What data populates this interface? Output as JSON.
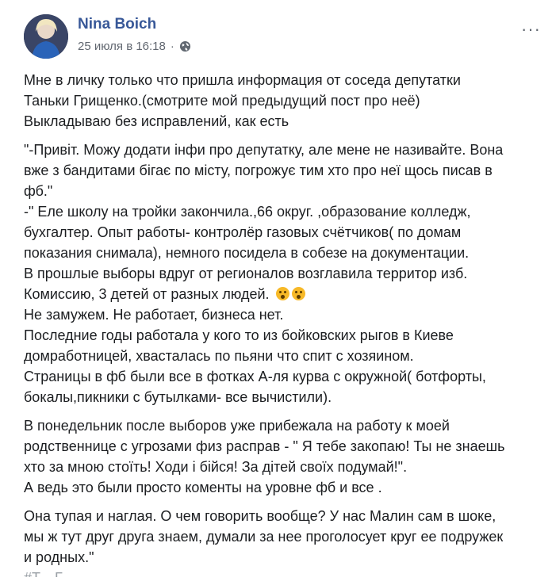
{
  "post": {
    "author": "Nina Boich",
    "timestamp": "25 июля в 16:18",
    "privacy_separator": "·",
    "privacy_icon": "globe-icon",
    "more_icon": "more-options-icon",
    "more_glyph": "···"
  },
  "content": {
    "paragraphs": [
      {
        "lines": [
          "Мне в личку только что пришла информация от соседа депутатки",
          "Таньки Грищенко.(смотрите мой предыдущий пост про неё)",
          "Выкладываю без исправлений, как есть"
        ]
      },
      {
        "lines": [
          "\"-Привіт. Можу додати інфи про депутатку, але мене не називайте. Вона",
          "вже з бандитами бігає по місту, погрожує тим хто про неї щось писав в",
          "фб.\"",
          "-\" Еле школу на тройки закончила.,66 округ. ,образование колледж,",
          "бухгалтер. Опыт работы- контролёр газовых счётчиков( по домам",
          "показания снимала), немного посидела в собезе на документации.",
          "В прошлые выборы вдруг от регионалов возглавила территор изб.",
          "Комиссию, 3 детей от разных людей.",
          "Не замужем. Не работает, бизнеса нет.",
          "Последние годы работала у кого то из бойковских рыгов в Киеве",
          "домработницей, хвасталась по пьяни что спит с хозяином.",
          "Страницы в фб были все в фотках А-ля курва с окружной( ботфорты,",
          "бокалы,пикники с бутылками- все вычистили)."
        ]
      },
      {
        "lines": [
          "В понедельник после выборов уже прибежала на работу к моей",
          "родственнице с угрозами физ расправ - \" Я тебе закопаю! Ты не знаешь",
          "хто за мною стоїть! Ходи і бійся! За дітей своїх подумай!\".",
          "А ведь это были просто коменты на уровне фб и все ."
        ]
      },
      {
        "lines": [
          "Она тупая и наглая. О чем говорить вообще? У нас Малин сам в шоке,",
          "мы ж тут друг друга знаем, думали за нее проголосует круг ее подружек",
          "и родных.\""
        ]
      }
    ],
    "cutoff_line": "#Т...   Г..."
  },
  "colors": {
    "author": "#385898",
    "meta": "#616770",
    "text": "#1c1e21",
    "emoji": "#f7b928"
  }
}
